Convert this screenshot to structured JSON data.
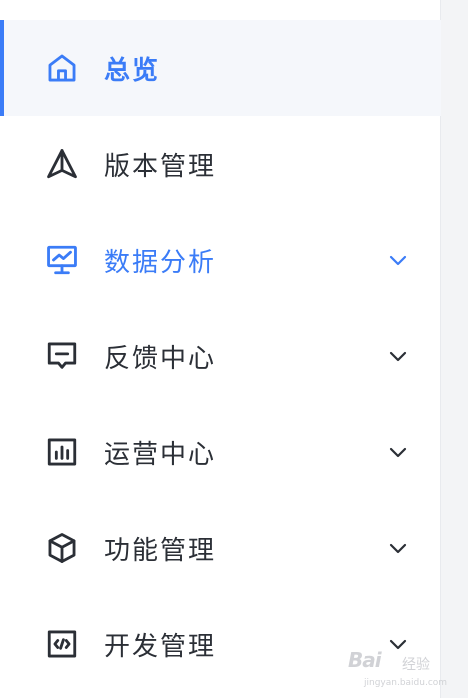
{
  "colors": {
    "accent": "#3b7cf7",
    "text": "#2b2f36",
    "active_bg": "#f5f7fb"
  },
  "menu": [
    {
      "label": "总览",
      "icon": "home-icon",
      "active": true
    },
    {
      "label": "版本管理",
      "icon": "paper-plane-icon"
    },
    {
      "label": "数据分析",
      "icon": "monitor-chart-icon",
      "expanded": true
    },
    {
      "label": "反馈中心",
      "icon": "message-square-icon"
    },
    {
      "label": "运营中心",
      "icon": "bar-chart-icon"
    },
    {
      "label": "功能管理",
      "icon": "cube-icon"
    },
    {
      "label": "开发管理",
      "icon": "code-window-icon"
    }
  ],
  "watermark": {
    "brand": "Bai",
    "sub": "经验",
    "url": "jingyan.baidu.com"
  }
}
